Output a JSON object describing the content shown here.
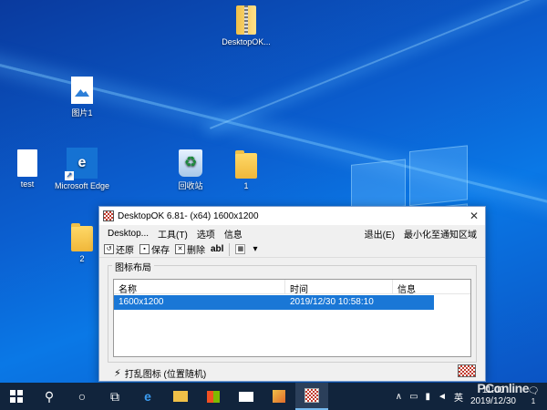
{
  "desktop": {
    "icons": [
      {
        "label": "DesktopOK...",
        "icon": "zip-folder-icon"
      },
      {
        "label": "图片1",
        "icon": "image-file-icon"
      },
      {
        "label": "test",
        "icon": "blank-file-icon"
      },
      {
        "label": "Microsoft Edge",
        "icon": "edge-icon"
      },
      {
        "label": "回收站",
        "icon": "recycle-bin-icon"
      },
      {
        "label": "1",
        "icon": "folder-icon"
      },
      {
        "label": "2",
        "icon": "folder-icon"
      }
    ],
    "edge_glyph": "e",
    "shortcut_glyph": "↗"
  },
  "window": {
    "title": "DesktopOK 6.81- (x64) 1600x1200",
    "close_glyph": "✕",
    "menu": {
      "items": [
        "Desktop...",
        "工具(T)",
        "选项",
        "信息"
      ],
      "exit": "退出(E)",
      "minimize_tray": "最小化至通知区域"
    },
    "toolbar": {
      "restore": "还原",
      "save": "保存",
      "delete": "删除",
      "abl": "abl",
      "dropdown": "▾"
    },
    "group_label": "图标布局",
    "list": {
      "columns": [
        "名称",
        "时间",
        "信息"
      ],
      "rows": [
        {
          "name": "1600x1200",
          "time": "2019/12/30 10:58:10",
          "info": ""
        }
      ]
    },
    "status": "打乱图标 (位置随机)",
    "status_glyph": "⚡"
  },
  "taskbar": {
    "search_glyph": "⚲",
    "cortana_glyph": "○",
    "taskview_glyph": "⧉",
    "tray_chevron": "∧",
    "ime": "英",
    "time": "11:00",
    "date": "2019/12/30",
    "notification_count": "1",
    "notification_glyph": "🗨"
  },
  "watermark": "PConline",
  "colors": {
    "selection": "#1a77d6",
    "taskbar": "#11243c"
  }
}
